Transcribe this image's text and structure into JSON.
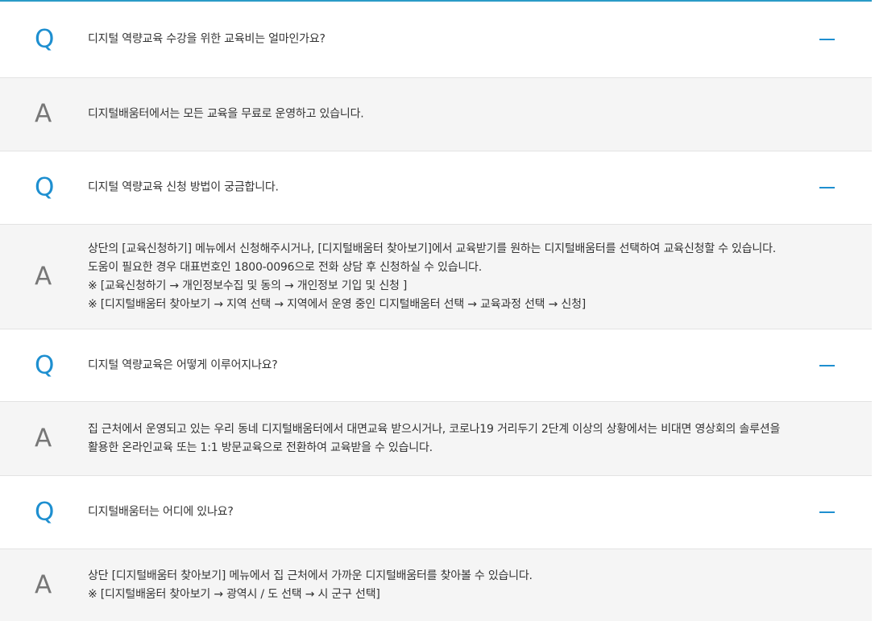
{
  "marks": {
    "question": "Q",
    "answer": "A"
  },
  "faq": [
    {
      "question": "디지털 역량교육 수강을 위한 교육비는 얼마인가요?",
      "answer_lines": [
        "디지털배움터에서는 모든 교육을 무료로 운영하고 있습니다."
      ]
    },
    {
      "question": "디지털 역량교육 신청 방법이 궁금합니다.",
      "answer_lines": [
        "상단의 [교육신청하기] 메뉴에서 신청해주시거나, [디지털배움터 찾아보기]에서 교육받기를 원하는 디지털배움터를 선택하여 교육신청할 수 있습니다.",
        "도움이 필요한 경우 대표번호인 1800-0096으로 전화 상담 후 신청하실 수 있습니다.",
        "※ [교육신청하기 → 개인정보수집 및 동의 → 개인정보 기입 및 신청 ]",
        "※ [디지털배움터 찾아보기 → 지역 선택 → 지역에서 운영 중인 디지털배움터 선택 → 교육과정 선택 → 신청]"
      ]
    },
    {
      "question": "디지털 역량교육은 어떻게 이루어지나요?",
      "answer_lines": [
        "집 근처에서 운영되고 있는 우리 동네 디지털배움터에서 대면교육 받으시거나, 코로나19 거리두기 2단계 이상의 상황에서는 비대면 영상회의 솔루션을",
        "활용한 온라인교육 또는 1:1 방문교육으로 전환하여 교육받을 수 있습니다."
      ]
    },
    {
      "question": "디지털배움터는 어디에 있나요?",
      "answer_lines": [
        "상단 [디지털배움터 찾아보기] 메뉴에서 집 근처에서 가까운 디지털배움터를 찾아볼 수 있습니다.",
        "※ [디지털배움터 찾아보기 → 광역시 / 도 선택 → 시 군구 선택]"
      ]
    }
  ],
  "colors": {
    "accent": "#1e8fd0",
    "top_border": "#2a9bc7",
    "answer_bg": "#f5f5f5",
    "answer_mark": "#777777",
    "text": "#333333"
  },
  "icons": {
    "toggle": "minus-icon"
  }
}
